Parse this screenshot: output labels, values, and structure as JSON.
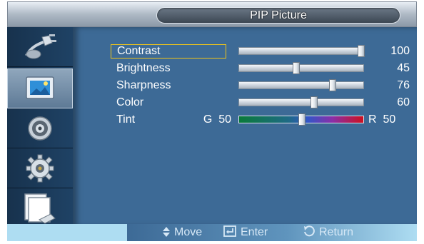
{
  "title": "PIP Picture",
  "sidebar": {
    "items": [
      {
        "icon": "input-plug-icon"
      },
      {
        "icon": "picture-icon",
        "active": true
      },
      {
        "icon": "speaker-icon"
      },
      {
        "icon": "gear-icon"
      },
      {
        "icon": "multi-screen-icon"
      }
    ]
  },
  "settings": [
    {
      "label": "Contrast",
      "value": "100",
      "level": 100,
      "selected": true
    },
    {
      "label": "Brightness",
      "value": "45",
      "level": 45
    },
    {
      "label": "Sharpness",
      "value": "76",
      "level": 76
    },
    {
      "label": "Color",
      "value": "60",
      "level": 60
    }
  ],
  "tint": {
    "label": "Tint",
    "left_label": "G  50",
    "right_label": "R  50",
    "level": 50
  },
  "hints": {
    "move": "Move",
    "enter": "Enter",
    "return": "Return"
  },
  "colors": {
    "panel": "#3d6a96",
    "highlight": "#f0c419",
    "helpbar": "#aeddf2"
  }
}
